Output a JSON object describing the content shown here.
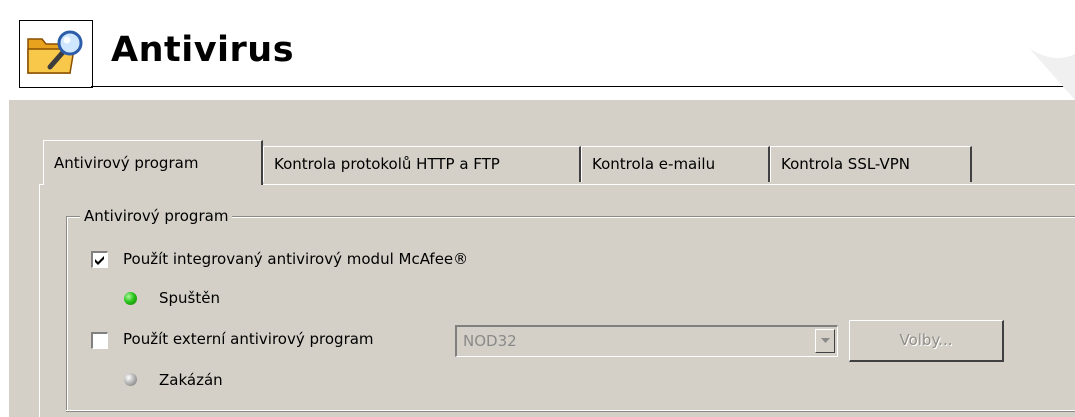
{
  "header": {
    "title": "Antivirus",
    "icon": "folder-magnifier-icon"
  },
  "tabs": [
    {
      "label": "Antivirový program",
      "active": true
    },
    {
      "label": "Kontrola protokolů HTTP a FTP",
      "active": false
    },
    {
      "label": "Kontrola e-mailu",
      "active": false
    },
    {
      "label": "Kontrola SSL-VPN",
      "active": false
    }
  ],
  "group": {
    "legend": "Antivirový program",
    "integrated": {
      "label": "Použít integrovaný antivirový modul McAfee®",
      "checked": true,
      "status_label": "Spuštěn",
      "status_color": "#29c41a"
    },
    "external": {
      "label": "Použít externí antivirový program",
      "checked": false,
      "select_value": "NOD32",
      "options_button": "Volby...",
      "status_label": "Zakázán",
      "status_color": "#b9b9b9"
    }
  }
}
